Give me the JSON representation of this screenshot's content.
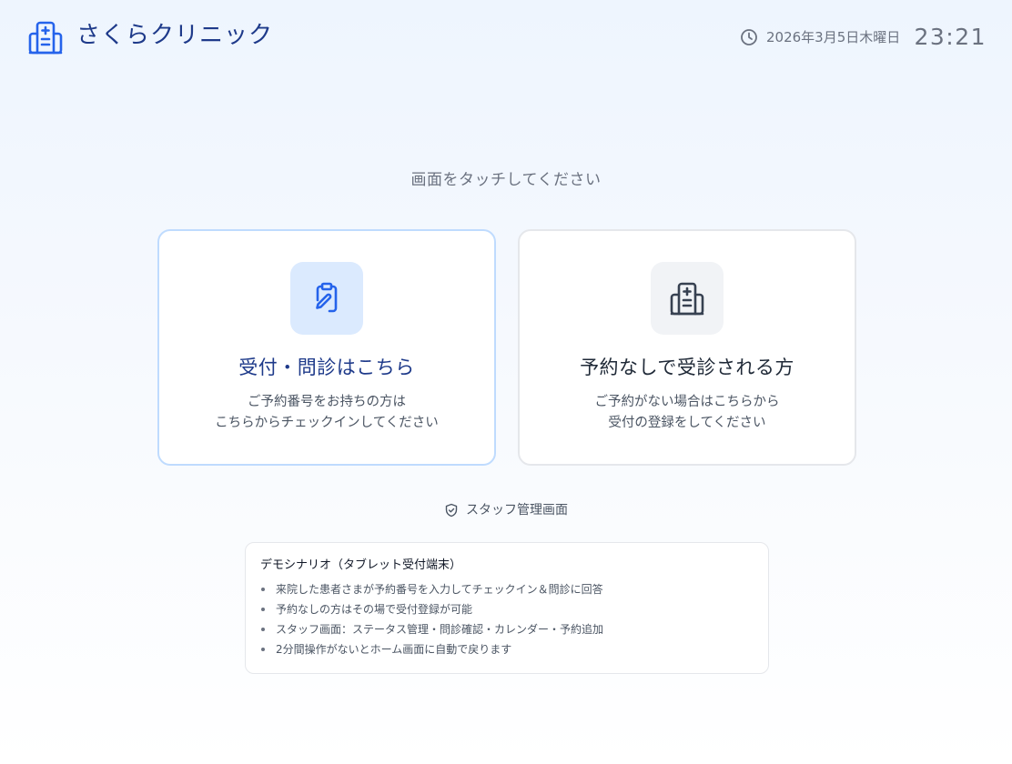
{
  "header": {
    "clinic_name": "さくらクリニック",
    "logo_icon": "hospital-building-icon",
    "clock_icon": "clock-icon",
    "date": "2026年3月5日木曜日",
    "time": "23:21"
  },
  "main": {
    "prompt": "画面をタッチしてください",
    "cards": [
      {
        "icon": "clipboard-pen-icon",
        "title": "受付・問診はこちら",
        "desc_lines": [
          "ご予約番号をお持ちの方は",
          "こちらからチェックインしてください"
        ]
      },
      {
        "icon": "hospital-building-icon",
        "title": "予約なしで受診される方",
        "desc_lines": [
          "ご予約がない場合はこちらから",
          "受付の登録をしてください"
        ]
      }
    ]
  },
  "staff_link": {
    "icon": "shield-check-icon",
    "label": "スタッフ管理画面"
  },
  "demo": {
    "title": "デモシナリオ（タブレット受付端末）",
    "items": [
      "来院した患者さまが予約番号を入力してチェックイン＆問診に回答",
      "予約なしの方はその場で受付登録が可能",
      "スタッフ画面：ステータス管理・問診確認・カレンダー・予約追加",
      "2分間操作がないとホーム画面に自動で戻ります"
    ]
  },
  "colors": {
    "brand_blue": "#2563eb",
    "dark_navy": "#1e3a8a",
    "icon_dark": "#374151"
  }
}
